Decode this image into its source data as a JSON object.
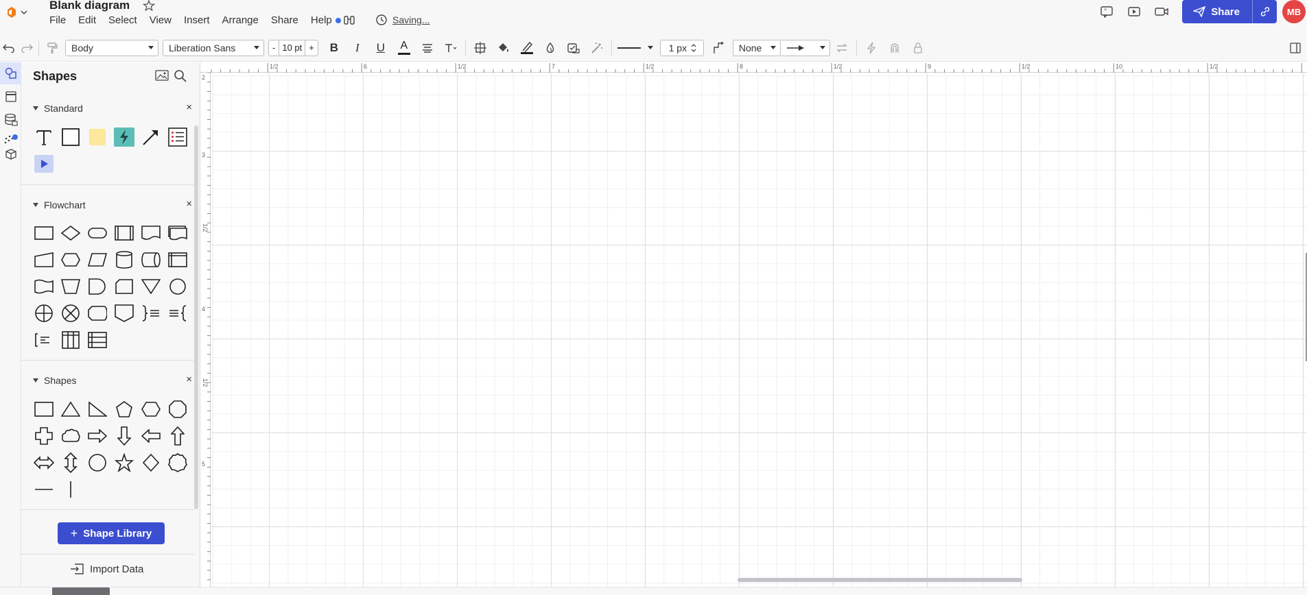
{
  "header": {
    "title": "Blank diagram",
    "menu": [
      "File",
      "Edit",
      "Select",
      "View",
      "Insert",
      "Arrange",
      "Share",
      "Help"
    ],
    "saving_label": "Saving...",
    "share_label": "Share",
    "avatar_initials": "MB",
    "accent_color": "#3b4ed0",
    "avatar_color": "#e64545"
  },
  "toolbar": {
    "text_style": "Body",
    "font": "Liberation Sans",
    "font_size": "10 pt",
    "minus": "-",
    "plus": "+",
    "bold": "B",
    "italic": "I",
    "underline": "U",
    "text_color_glyph": "A",
    "line_width": "1 px",
    "line_start": "None"
  },
  "panel": {
    "title": "Shapes",
    "sections": [
      {
        "name": "Standard"
      },
      {
        "name": "Flowchart"
      },
      {
        "name": "Shapes"
      }
    ],
    "close_glyph": "×",
    "shape_library_label": "Shape Library",
    "import_label": "Import Data"
  },
  "ruler": {
    "top_labels": [
      "1/2",
      "6",
      "1/2",
      "7",
      "1/2",
      "8",
      "1/2",
      "9",
      "1/2",
      "10",
      "1/2"
    ],
    "left_labels": [
      "2",
      "3",
      "1/2",
      "4",
      "1/2",
      "5"
    ]
  }
}
